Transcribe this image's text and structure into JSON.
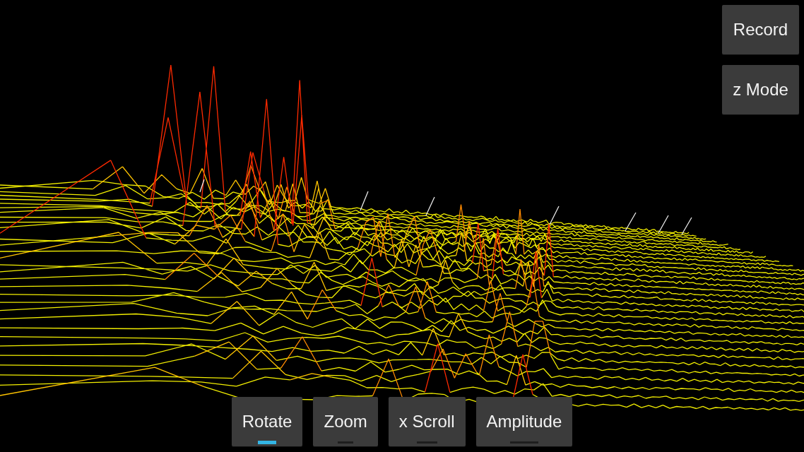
{
  "side_buttons": [
    {
      "label": "Record"
    },
    {
      "label": "z Mode"
    }
  ],
  "mode_tabs": [
    {
      "label": "Rotate",
      "selected": true
    },
    {
      "label": "Zoom",
      "selected": false
    },
    {
      "label": "x Scroll",
      "selected": false
    },
    {
      "label": "Amplitude",
      "selected": false
    }
  ]
}
